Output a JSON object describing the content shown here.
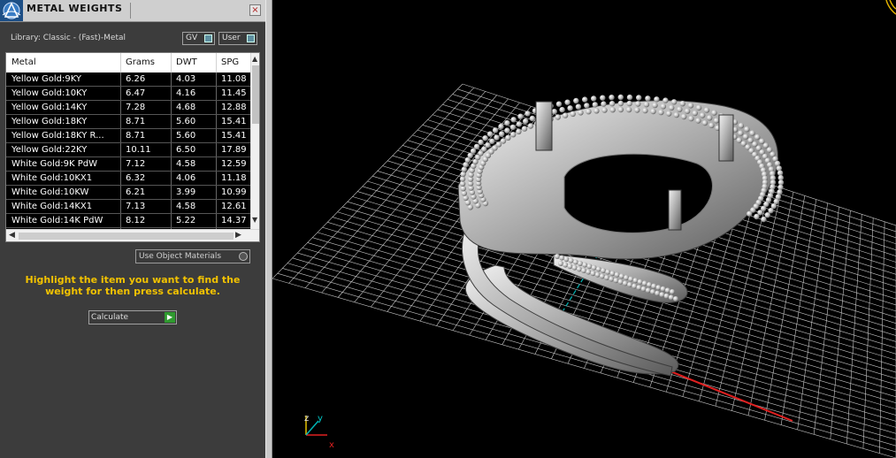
{
  "panel": {
    "title": "METAL WEIGHTS",
    "close_glyph": "×",
    "library": "Library: Classic - (Fast)-Metal",
    "toggles": {
      "gv": "GV",
      "user": "User"
    },
    "columns": [
      "Metal",
      "Grams",
      "DWT",
      "SPG"
    ],
    "rows": [
      [
        "Yellow Gold:9KY",
        "6.26",
        "4.03",
        "11.08"
      ],
      [
        "Yellow Gold:10KY",
        "6.47",
        "4.16",
        "11.45"
      ],
      [
        "Yellow Gold:14KY",
        "7.28",
        "4.68",
        "12.88"
      ],
      [
        "Yellow Gold:18KY",
        "8.71",
        "5.60",
        "15.41"
      ],
      [
        "Yellow Gold:18KY R...",
        "8.71",
        "5.60",
        "15.41"
      ],
      [
        "Yellow Gold:22KY",
        "10.11",
        "6.50",
        "17.89"
      ],
      [
        "White Gold:9K PdW",
        "7.12",
        "4.58",
        "12.59"
      ],
      [
        "White Gold:10KX1",
        "6.32",
        "4.06",
        "11.18"
      ],
      [
        "White Gold:10KW",
        "6.21",
        "3.99",
        "10.99"
      ],
      [
        "White Gold:14KX1",
        "7.13",
        "4.58",
        "12.61"
      ],
      [
        "White Gold:14K PdW",
        "8.12",
        "5.22",
        "14.37"
      ]
    ],
    "use_object_materials": "Use Object Materials",
    "instruction": "Highlight the item you want to find the weight for then press calculate.",
    "calculate": "Calculate"
  },
  "viewport": {
    "axis_labels": {
      "z": "z",
      "y": "y",
      "x": "x"
    },
    "axis_colors": {
      "x": "#e02020",
      "y": "#00b4b4",
      "z": "#e0c000"
    },
    "grid_color": "#c8c8c8",
    "model": "ring"
  },
  "colors": {
    "instruction": "#f2c200",
    "panel_bg": "#3c3c3c",
    "viewport_bg": "#000000"
  }
}
